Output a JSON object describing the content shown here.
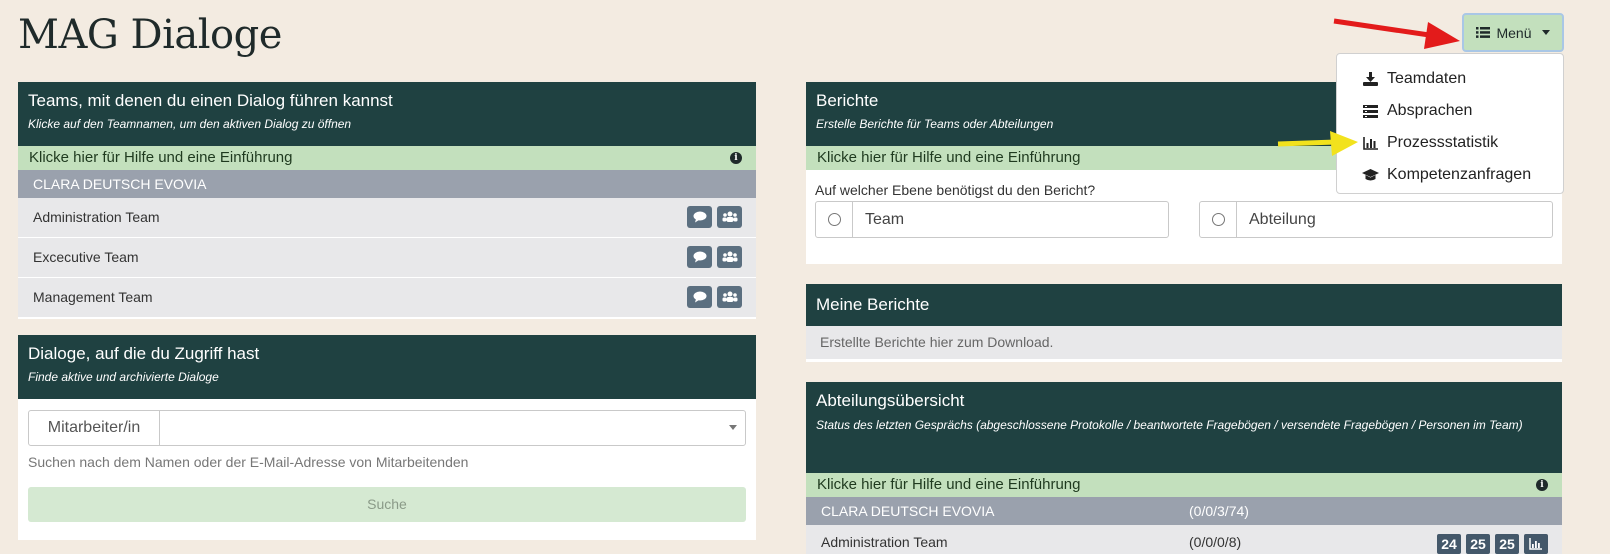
{
  "page_title": "MAG Dialoge",
  "menu": {
    "button_label": "Menü",
    "items": [
      {
        "label": "Teamdaten",
        "icon": "download-icon"
      },
      {
        "label": "Absprachen",
        "icon": "list-icon"
      },
      {
        "label": "Prozessstatistik",
        "icon": "bar-chart-icon"
      },
      {
        "label": "Kompetenzanfragen",
        "icon": "graduation-cap-icon"
      }
    ]
  },
  "teams_panel": {
    "title": "Teams, mit denen du einen Dialog führen kannst",
    "subtitle": "Klicke auf den Teamnamen, um den aktiven Dialog zu öffnen",
    "help": "Klicke hier für Hilfe und eine Einführung",
    "group": "Clara Deutsch Evovia",
    "teams": [
      "Administration Team",
      "Excecutive Team",
      "Management Team"
    ]
  },
  "dialoge_panel": {
    "title": "Dialoge, auf die du Zugriff hast",
    "subtitle": "Finde aktive und archivierte Dialoge",
    "addon_label": "Mitarbeiter/in",
    "select_value": "",
    "hint": "Suchen nach dem Namen oder der E-Mail-Adresse von Mitarbeitenden",
    "search_button": "Suche"
  },
  "berichte_panel": {
    "title": "Berichte",
    "subtitle": "Erstelle Berichte für Teams oder Abteilungen",
    "help": "Klicke hier für Hilfe und eine Einführung",
    "question": "Auf welcher Ebene benötigst du den Bericht?",
    "options": [
      "Team",
      "Abteilung"
    ]
  },
  "meine_berichte": {
    "title": "Meine Berichte",
    "empty": "Erstellte Berichte hier zum Download."
  },
  "abteilung_panel": {
    "title": "Abteilungsübersicht",
    "subtitle": "Status des letzten Gesprächs (abgeschlossene Protokolle / beantwortete Fragebögen / versendete Fragebögen / Personen im Team)",
    "help": "Klicke hier für Hilfe und eine Einführung",
    "group": "Clara Deutsch Evovia",
    "group_stat": "(0/0/3/74)",
    "rows": [
      {
        "name": "Administration Team",
        "stat": "(0/0/0/8)",
        "badges": [
          "24",
          "25",
          "25"
        ]
      }
    ]
  },
  "colors": {
    "header": "#1f4141",
    "help_bar": "#c3e0bd",
    "group_row": "#9aa1ad",
    "background": "#f3ebe1",
    "red_arrow": "#e31b1b",
    "yellow_arrow": "#f2e21d"
  }
}
